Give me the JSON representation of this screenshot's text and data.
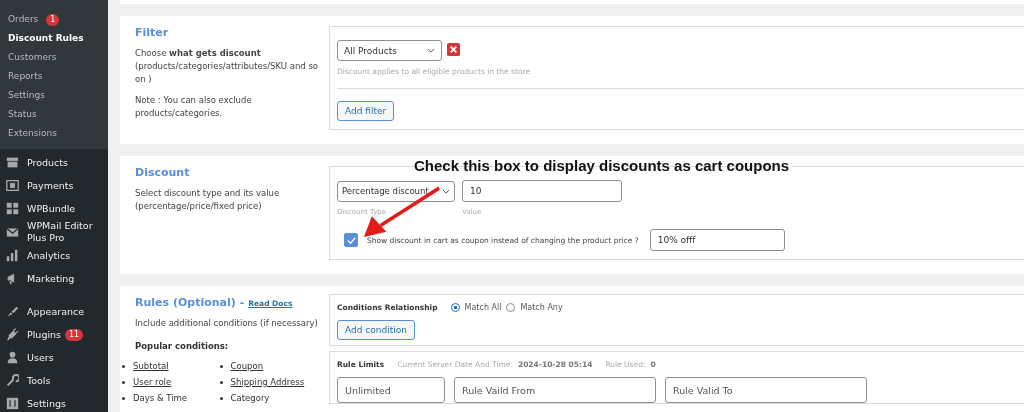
{
  "sidebar": {
    "submenu": [
      {
        "label": "Orders",
        "badge": "1",
        "selected": false
      },
      {
        "label": "Discount Rules",
        "selected": true
      },
      {
        "label": "Customers",
        "selected": false
      },
      {
        "label": "Reports",
        "selected": false
      },
      {
        "label": "Settings",
        "selected": false
      },
      {
        "label": "Status",
        "selected": false
      },
      {
        "label": "Extensions",
        "selected": false
      }
    ],
    "menu_groups": [
      [
        {
          "label": "Products"
        },
        {
          "label": "Payments"
        },
        {
          "label": "WPBundle"
        },
        {
          "label": "WPMail Editor Plus Pro"
        },
        {
          "label": "Analytics"
        },
        {
          "label": "Marketing"
        }
      ],
      [
        {
          "label": "Appearance"
        },
        {
          "label": "Plugins",
          "badge": "11"
        },
        {
          "label": "Users"
        },
        {
          "label": "Tools"
        },
        {
          "label": "Settings"
        }
      ]
    ]
  },
  "filter": {
    "title": "Filter",
    "description_1": "Choose **what gets discount** (products/categories/attributes/SKU and so on )",
    "description_2": "Note : You can also exclude products/categories.",
    "select": "All Products",
    "hint": "Discount applies to all eligible products in the store",
    "add_button": "Add filter"
  },
  "discount": {
    "title": "Discount",
    "description": "Select discount type and its value (percentage/price/fixed price)",
    "type_select": "Percentage discount",
    "type_label": "Discount Type",
    "value": "10",
    "value_label": "Value",
    "coupon_checked": true,
    "coupon_label": "Show discount in cart as coupon instead of changing the product price ?",
    "coupon_value": "10% offf"
  },
  "annotation": {
    "text": "Check this box to display discounts as cart coupons"
  },
  "rules": {
    "title": "Rules (Optional) -",
    "docs_link": "Read Docs",
    "description": "Include additional conditions (if necessary)",
    "popular_heading": "Popular conditions:",
    "conditions_columns": [
      [
        {
          "label": "Subtotal",
          "link": true
        },
        {
          "label": "User role",
          "link": true
        },
        {
          "label": "Days & Time",
          "link": false
        }
      ],
      [
        {
          "label": "Coupon",
          "link": true
        },
        {
          "label": "Shipping Address",
          "link": true
        },
        {
          "label": "Category",
          "link": false
        }
      ]
    ],
    "relationship_label": "Conditions Relationship",
    "relationship_options": [
      {
        "label": "Match All",
        "selected": true
      },
      {
        "label": "Match Any",
        "selected": false
      }
    ],
    "add_button": "Add condition",
    "limits_label": "Rule Limits",
    "server_time_label": "Current Server Date And Time:",
    "server_time": "2024-10-28 05:14",
    "rule_used_label": "Rule Used:",
    "rule_used": "0",
    "limit_fields": [
      {
        "placeholder": "Unlimited"
      },
      {
        "placeholder": "Rule Vaild From"
      },
      {
        "placeholder": "Rule Valid To"
      }
    ]
  }
}
